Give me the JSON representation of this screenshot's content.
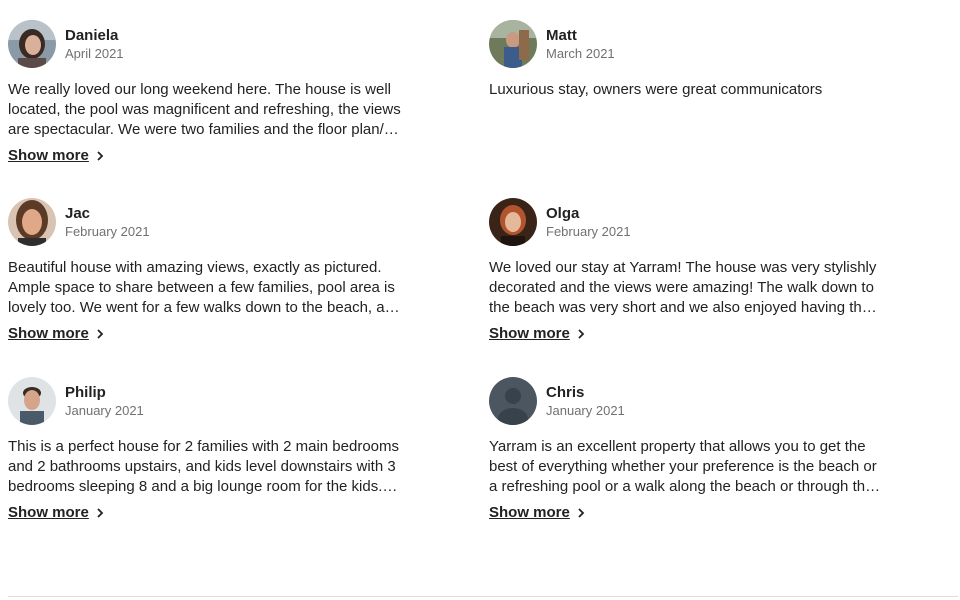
{
  "reviews": [
    {
      "name": "Daniela",
      "date": "April 2021",
      "text": "We really loved our long weekend here. The house is well located, the pool was magnificent and refreshing, the views are spectacular. We were two families and the floor plan/ layout...",
      "show_more": "Show more",
      "avatar": "photo-woman-dark-hair"
    },
    {
      "name": "Matt",
      "date": "March 2021",
      "text": "Luxurious stay, owners were great communicators",
      "show_more": "",
      "avatar": "photo-man-outdoors"
    },
    {
      "name": "Jac",
      "date": "February 2021",
      "text": "Beautiful house with amazing views, exactly as pictured. Ample space to share between a few families, pool area is lovely too. We went for a few walks down to the beach, and enjoyed...",
      "show_more": "Show more",
      "avatar": "photo-woman-smiling"
    },
    {
      "name": "Olga",
      "date": "February 2021",
      "text": "We loved our stay at Yarram! The house was very stylishly decorated and the views were amazing! The walk down to the beach was very short and we also enjoyed having the beautiful...",
      "show_more": "Show more",
      "avatar": "photo-woman-red-hair"
    },
    {
      "name": "Philip",
      "date": "January 2021",
      "text": "This is a perfect house for 2 families with 2 main bedrooms and 2 bathrooms upstairs, and kids level downstairs with 3 bedrooms sleeping 8 and a big lounge room for the kids. The...",
      "show_more": "Show more",
      "avatar": "photo-man-short-hair"
    },
    {
      "name": "Chris",
      "date": "January 2021",
      "text": "Yarram is an excellent property that allows you to get the best of everything whether your preference is the beach or a refreshing pool or a walk along the beach or through the bush...",
      "show_more": "Show more",
      "avatar": "default-silhouette"
    }
  ],
  "colors": {
    "text": "#222222",
    "muted": "#717171",
    "divider": "#dddddd"
  }
}
